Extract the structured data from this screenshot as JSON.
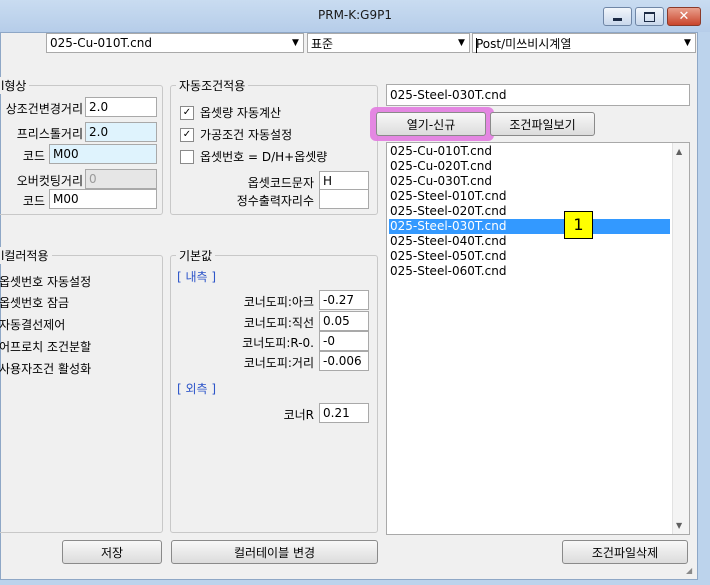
{
  "window": {
    "title": "PRM-K:G9P1"
  },
  "top_combos": {
    "file": "025-Cu-010T.cnd",
    "mode": "표준",
    "post": "Post/미쓰비시계열"
  },
  "left_group": {
    "title": "l형상",
    "rows": [
      {
        "label": "상조건변경거리",
        "value": "2.0"
      },
      {
        "label": "프리스톨거리",
        "value": "2.0"
      },
      {
        "label": "코드",
        "value": "M00"
      },
      {
        "label": "오버컷팅거리",
        "value": "0"
      },
      {
        "label": "코드",
        "value": "M00"
      }
    ]
  },
  "auto_group": {
    "title": "자동조건적용",
    "checks": [
      {
        "label": "옵셋량 자동계산",
        "checked": "✓"
      },
      {
        "label": "가공조건 자동설정",
        "checked": "✓"
      },
      {
        "label": "옵셋번호 = D/H+옵셋량",
        "checked": ""
      }
    ],
    "offset_code_label": "옵셋코드문자",
    "offset_code_value": "H",
    "int_digits_label": "정수출력자리수",
    "int_digits_value": ""
  },
  "cutter_group": {
    "title": "l컬러적용",
    "items": [
      "옵셋번호 자동설정",
      "옵셋번호 잠금",
      "자동결선제어",
      "어프로치 조건분할",
      "사용자조건 활성화"
    ]
  },
  "basic_group": {
    "title": "기본값",
    "inner_label": "[ 내측 ]",
    "rows": [
      {
        "label": "코너도피:아크",
        "value": "-0.27"
      },
      {
        "label": "코너도피:직선",
        "value": "0.05"
      },
      {
        "label": "코너도피:R-0.",
        "value": "-0"
      },
      {
        "label": "코너도피:거리",
        "value": "-0.006"
      }
    ],
    "outer_label": "[ 외측 ]",
    "corner_label": "코너R",
    "corner_value": "0.21"
  },
  "right_panel": {
    "filename_value": "025-Steel-030T.cnd",
    "open_button": "열기-신규",
    "view_button": "조건파일보기",
    "files": [
      "025-Cu-010T.cnd",
      "025-Cu-020T.cnd",
      "025-Cu-030T.cnd",
      "025-Steel-010T.cnd",
      "025-Steel-020T.cnd",
      "025-Steel-030T.cnd",
      "025-Steel-040T.cnd",
      "025-Steel-050T.cnd",
      "025-Steel-060T.cnd"
    ],
    "selected_index": 5,
    "badge": "1"
  },
  "bottom_buttons": {
    "save": "저장",
    "cutter_table": "컬러테이블 변경",
    "delete_file": "조건파일삭제"
  },
  "colors": {
    "highlight": "#e27be0",
    "selection": "#3399ff",
    "badge": "#ffff00"
  }
}
